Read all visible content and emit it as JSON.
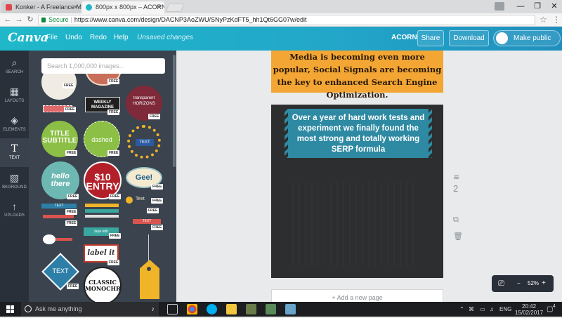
{
  "browser": {
    "tabs": [
      {
        "title": "Konker - A Freelance Ma",
        "fav_color": "#e0474c"
      },
      {
        "title": "800px x 800px – ACORN",
        "fav_color": "#1fb8c9"
      }
    ],
    "window_controls": [
      "—",
      "❐",
      "✕"
    ],
    "url_secure": "Secure",
    "url": "https://www.canva.com/design/DACNP3AoZWU/SNyPzKdFT5_hh1Qt6GG07w/edit"
  },
  "app": {
    "logo": "Canva",
    "menu": [
      "File",
      "Undo",
      "Redo",
      "Help"
    ],
    "status": "Unsaved changes",
    "design_name": "ACORN",
    "share": "Share",
    "download": "Download",
    "make_public": "Make public"
  },
  "rail": [
    {
      "label": "SEARCH",
      "icon": "search-icon",
      "glyph": "⌕"
    },
    {
      "label": "LAYOUTS",
      "icon": "layouts-icon",
      "glyph": "▦"
    },
    {
      "label": "ELEMENTS",
      "icon": "elements-icon",
      "glyph": "◈"
    },
    {
      "label": "TEXT",
      "icon": "text-icon",
      "glyph": "T"
    },
    {
      "label": "BKGROUND",
      "icon": "background-icon",
      "glyph": "▧"
    },
    {
      "label": "UPLOADS",
      "icon": "upload-icon",
      "glyph": "↑"
    }
  ],
  "panel": {
    "search_placeholder": "Search 1,000,000 images...",
    "free_label": "FREE",
    "items": [
      {
        "text": "dotted"
      },
      {
        "text": "WEEKLY MAGAZINE"
      },
      {
        "text": "transparent HORIZONS"
      },
      {
        "text": "TITLE SUBTITLE"
      },
      {
        "text": "dashed"
      },
      {
        "text": "TEXT"
      },
      {
        "text": "hello there"
      },
      {
        "text": "$10 ENTRY"
      },
      {
        "text": "Gee!"
      },
      {
        "text": "Text"
      },
      {
        "text": "TEXT"
      },
      {
        "text": "TEXT"
      },
      {
        "text": "TEXT"
      },
      {
        "text": "tape edit"
      },
      {
        "text": "label it"
      },
      {
        "text": "TEXT"
      },
      {
        "text": "CLASSIC MONOCHROME"
      }
    ]
  },
  "canvas": {
    "page1_text": "Media is becoming even more popular, Social Signals are becoming the key to enhanced Search Engine Optimization.",
    "page2_text": "Over a year of hard work tests and experiment we finally found the most strong and totally working SERP formula",
    "page_number": "2",
    "add_page": "+ Add a new page",
    "zoom": "52%",
    "zoom_minus": "−",
    "zoom_plus": "+"
  },
  "taskbar": {
    "search": "Ask me anything",
    "lang": "ENG",
    "time": "20:42",
    "date": "15/02/2017",
    "notifications": "4"
  }
}
